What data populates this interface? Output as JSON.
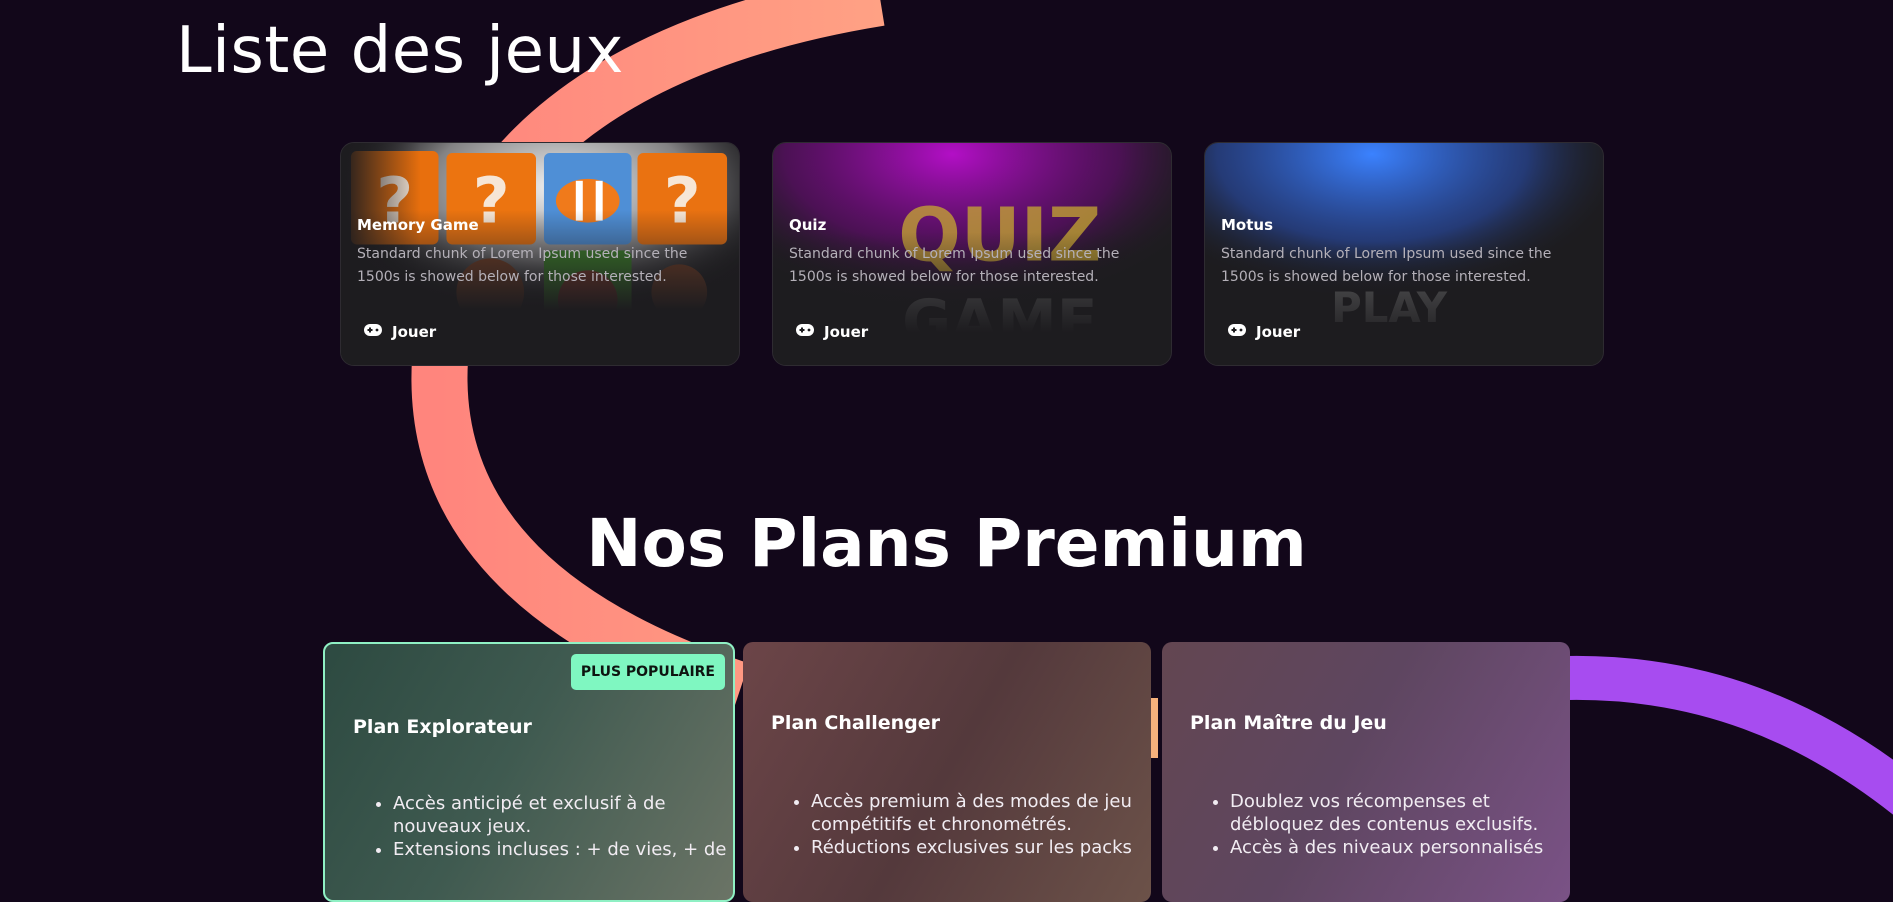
{
  "page_title": "Liste des jeux",
  "games": [
    {
      "title": "Memory Game",
      "description": "Standard chunk of Lorem Ipsum used since the 1500s is showed below for those interested.",
      "play_label": "Jouer"
    },
    {
      "title": "Quiz",
      "description": "Standard chunk of Lorem Ipsum used since the 1500s is showed below for those interested.",
      "play_label": "Jouer"
    },
    {
      "title": "Motus",
      "description": "Standard chunk of Lorem Ipsum used since the 1500s is showed below for those interested.",
      "play_label": "Jouer"
    }
  ],
  "plans_title": "Nos Plans Premium",
  "plans": [
    {
      "name": "Plan Explorateur",
      "badge": "PLUS POPULAIRE",
      "features": [
        "Accès anticipé et exclusif à de nouveaux jeux.",
        "Extensions incluses : + de vies, + de"
      ]
    },
    {
      "name": "Plan Challenger",
      "features": [
        "Accès premium à des modes de jeu compétitifs et chronométrés.",
        "Réductions exclusives sur les packs"
      ]
    },
    {
      "name": "Plan Maître du Jeu",
      "features": [
        "Doublez vos récompenses et débloquez des contenus exclusifs.",
        "Accès à des niveaux personnalisés"
      ]
    }
  ],
  "colors": {
    "background": "#12071a",
    "arc_salmon": "#ff8a80",
    "arc_purple": "#a74cf0",
    "badge": "#7ff7c1",
    "explorer_border": "#8ff0c4"
  },
  "icons": {
    "play": "gamepad-icon"
  }
}
